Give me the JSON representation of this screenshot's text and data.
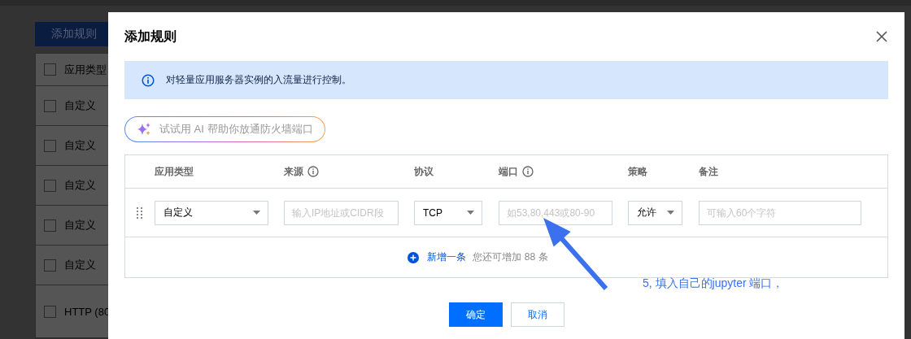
{
  "background_page": {
    "add_button": "添加规则",
    "table": {
      "header": {
        "label": "应用类型",
        "checked": false
      },
      "rows": [
        {
          "label": "自定义",
          "checked": false
        },
        {
          "label": "自定义",
          "checked": false
        },
        {
          "label": "自定义",
          "checked": false
        },
        {
          "label": "自定义",
          "checked": false
        },
        {
          "label": "自定义",
          "checked": false
        },
        {
          "label": "HTTP (80",
          "checked": false
        }
      ]
    }
  },
  "dialog": {
    "title": "添加规则",
    "notice": "对轻量应用服务器实例的入流量进行控制。",
    "ai_button": "试试用 AI 帮助你放通防火墙端口",
    "table": {
      "columns": [
        {
          "label": "应用类型",
          "info": false
        },
        {
          "label": "来源",
          "info": true
        },
        {
          "label": "协议",
          "info": false
        },
        {
          "label": "端口",
          "info": true
        },
        {
          "label": "策略",
          "info": false
        },
        {
          "label": "备注",
          "info": false
        }
      ],
      "rows": [
        {
          "app_type": "自定义",
          "source_placeholder": "输入IP地址或CIDR段",
          "protocol": "TCP",
          "port_placeholder": "如53,80,443或80-90",
          "policy": "允许",
          "note_placeholder": "可输入60个字符"
        }
      ]
    },
    "add_link": "新增一条",
    "add_hint": "您还可增加 88 条",
    "buttons": [
      {
        "label": "确定",
        "kind": "primary"
      },
      {
        "label": "取消",
        "kind": "secondary"
      }
    ]
  },
  "annotation": {
    "text": "5, 填入自己的jupyter 端口，"
  }
}
